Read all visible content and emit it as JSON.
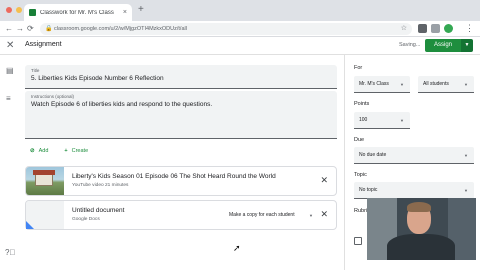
{
  "browser": {
    "tab_title": "Classwork for Mr. M's Class",
    "tab_close": "×",
    "new_tab": "+",
    "url": "classroom.google.com/u/2/w/MjgzOTI4MzkxODUz/t/all",
    "back": "←",
    "forward": "→",
    "reload": "⟳",
    "menu": "⋮",
    "window_dot_colors": [
      "#ed6a5e",
      "#f5bf4f",
      "#61c554"
    ]
  },
  "header": {
    "close_glyph": "✕",
    "title": "Assignment",
    "saving_text": "Saving...",
    "assign_label": "Assign",
    "assign_dropdown": "▼"
  },
  "form": {
    "title_label": "Title",
    "title_value": "5. Liberties Kids Episode Number 6 Reflection",
    "instructions_label": "Instructions (optional)",
    "instructions_value": "Watch Episode 6 of liberties kids and respond to the questions.",
    "add_label": "Add",
    "create_label": "Create"
  },
  "attachments": [
    {
      "title": "Liberty's Kids Season 01 Episode 06 The Shot Heard Round the World",
      "subtitle": "YouTube video   21 minutes"
    },
    {
      "title": "Untitled document",
      "subtitle": "Google Docs",
      "copy_option": "Make a copy for each student"
    }
  ],
  "settings": {
    "for_label": "For",
    "class_value": "Mr. M's Class",
    "students_value": "All students",
    "points_label": "Points",
    "points_value": "100",
    "due_label": "Due",
    "due_value": "No due date",
    "topic_label": "Topic",
    "topic_value": "No topic",
    "rubric_label": "Rubri"
  },
  "colors": {
    "accent": "#1e8e3e",
    "accent_dark": "#137333"
  },
  "icons": {
    "add": "paperclip-icon",
    "create": "plus-icon"
  }
}
